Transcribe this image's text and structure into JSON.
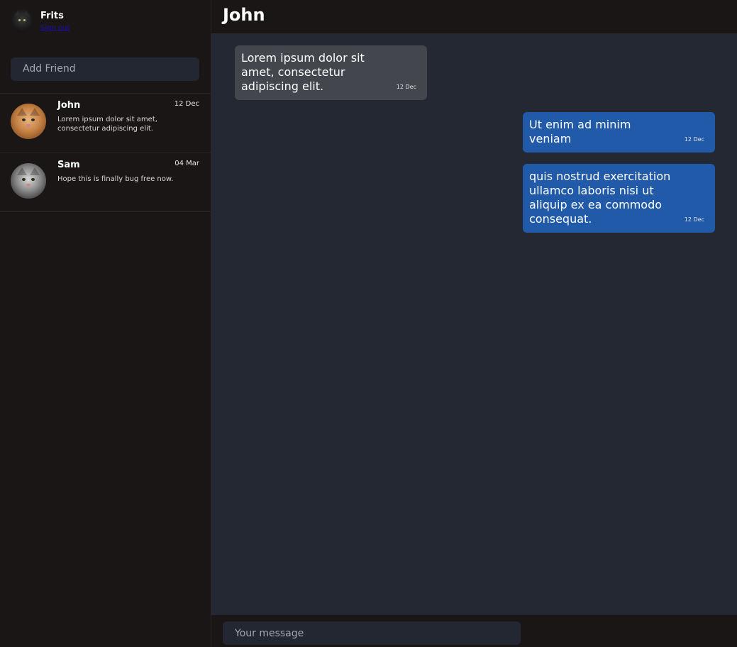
{
  "profile": {
    "name": "Frits",
    "link_label": "Sign out"
  },
  "sidebar": {
    "add_friend_placeholder": "Add Friend",
    "contacts": [
      {
        "name": "John",
        "date": "12 Dec",
        "preview": "Lorem ipsum dolor sit amet, consectetur adipiscing elit.",
        "avatar": "cat-orange"
      },
      {
        "name": "Sam",
        "date": "04 Mar",
        "preview": "Hope this is finally bug free now.",
        "avatar": "cat-grey"
      }
    ]
  },
  "chat": {
    "title": "John",
    "messages": [
      {
        "direction": "incoming",
        "text": "Lorem ipsum dolor sit amet, consectetur adipiscing elit.",
        "time": "12 Dec"
      },
      {
        "direction": "outgoing",
        "text": "Ut enim ad minim veniam",
        "time": "12 Dec"
      },
      {
        "direction": "outgoing",
        "text": "quis nostrud exercitation ullamco laboris nisi ut aliquip ex ea commodo consequat.",
        "time": "12 Dec"
      }
    ]
  },
  "composer": {
    "placeholder": "Your message"
  },
  "colors": {
    "sidebar_bg": "#1b1616",
    "chat_bg": "#242833",
    "incoming_bubble": "#43464d",
    "outgoing_bubble": "#215aa9",
    "input_bg": "#222732",
    "link": "#1a0dab"
  }
}
